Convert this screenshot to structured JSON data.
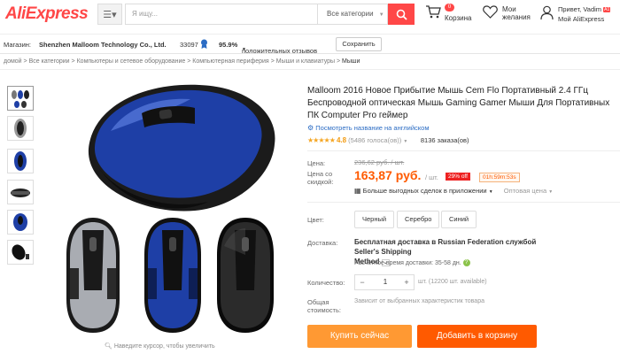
{
  "header": {
    "logo": "AliExpress",
    "search_placeholder": "Я ищу...",
    "category_select": "Все категории",
    "cart_count": "0",
    "cart_label": "Корзина",
    "wishlist_label_1": "Мои",
    "wishlist_label_2": "желания",
    "greeting": "Привет, Vadim",
    "account_badge": "A1",
    "my_account": "Мой AliExpress"
  },
  "store": {
    "label": "Магазин:",
    "name": "Shenzhen Malloom Technology Co., Ltd.",
    "score": "33097",
    "positive": "95.9%",
    "positive_label": "положительных отзывов",
    "save_button": "Сохранить"
  },
  "breadcrumb": {
    "items": [
      "домой",
      "Все категории",
      "Компьютеры и сетевое оборудование",
      "Компьютерная периферия",
      "Мыши и клавиатуры"
    ],
    "current": "Мыши",
    "separator": ">"
  },
  "product": {
    "title": "Malloom 2016 Новое Прибытие Мышь Cem Flo Портативный 2.4 ГГц Беспроводной оптическая Мышь Gaming Gamer Мыши Для Портативных ПК Computer Pro геймер",
    "translate_link": "Посмотреть название на английском",
    "stars": "★★★★★",
    "rating": "4.8",
    "votes": "(5486 голоса(ов))",
    "orders": "8136 заказа(ов)",
    "price_label": "Цена:",
    "old_price": "236,62 руб. / шт.",
    "discount_label_1": "Цена со",
    "discount_label_2": "скидкой:",
    "new_price": "163,87 руб.",
    "per_unit": "/ шт.",
    "off_badge": "29% off",
    "timer": "01h:59m:53s",
    "deals": "Больше выгодных сделок в приложении",
    "wholesale": "Оптовая цена",
    "color_label": "Цвет:",
    "colors": [
      "Черный",
      "Серебро",
      "Синий"
    ],
    "shipping_label": "Доставка:",
    "shipping_text_1": "Бесплатная доставка в Russian Federation службой Seller's Shipping",
    "shipping_text_2": "Method",
    "delivery_time": "Расчетное время доставки: 35-58 дн.",
    "qty_label": "Количество:",
    "qty_minus": "−",
    "qty_value": "1",
    "qty_plus": "+",
    "qty_available": "шт. (12200 шт. available)",
    "total_label_1": "Общая",
    "total_label_2": "стоимость:",
    "total_note": "Зависит от выбранных характеристик товара",
    "buy_now": "Купить сейчас",
    "add_to_cart": "Добавить в корзину",
    "zoom_hint": "Наведите курсор, чтобы увеличить"
  },
  "colors": {
    "brand": "#ff4747",
    "price": "#ff5a00",
    "buy_now": "#ff9933",
    "add_cart": "#ff5a00",
    "mouse_blue": "#1e3fa6"
  }
}
